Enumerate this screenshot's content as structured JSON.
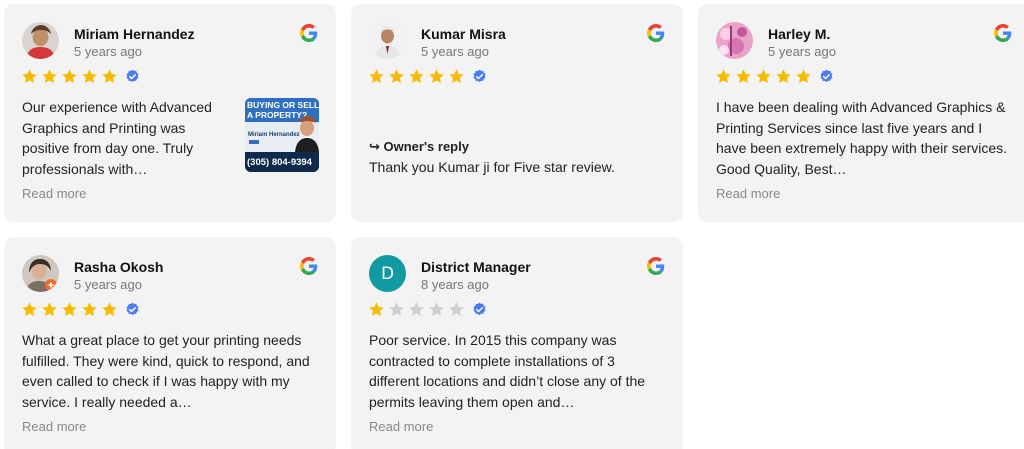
{
  "colors": {
    "card_bg": "#f3f3f3",
    "star_filled": "#f6bb06",
    "star_empty": "#cfcfcf",
    "verified_badge": "#4a7cf6",
    "district_avatar_bg": "#119aa2"
  },
  "reviews": [
    {
      "name": "Miriam Hernandez",
      "time_ago": "5 years ago",
      "rating": 5,
      "verified": true,
      "text": "Our experience with Advanced Graphics and Printing was positive from day one. Truly professionals with…",
      "read_more": "Read more",
      "attachment": {
        "headline_1": "BUYING OR SELLIN",
        "headline_2": "A PROPERTY?",
        "agent_name": "Miriam Hernandez",
        "phone": "(305) 804-9394"
      },
      "icon": "google-icon"
    },
    {
      "name": "Kumar Misra",
      "time_ago": "5 years ago",
      "rating": 5,
      "verified": true,
      "owner_reply_label": "↪ Owner's reply",
      "owner_reply_text": "Thank you Kumar ji for Five star review.",
      "icon": "google-icon"
    },
    {
      "name": "Harley M.",
      "time_ago": "5 years ago",
      "rating": 5,
      "verified": true,
      "text": "I have been dealing with Advanced Graphics & Printing Services since last five years and I have been extremely happy with their services. Good Quality, Best…",
      "read_more": "Read more",
      "icon": "google-icon"
    },
    {
      "name": "Rasha Okosh",
      "time_ago": "5 years ago",
      "rating": 5,
      "verified": true,
      "text": "What a great place to get your printing needs fulfilled. They were kind, quick to respond, and even called to check if I was happy with my service. I really needed a…",
      "read_more": "Read more",
      "icon": "google-icon"
    },
    {
      "name": "District Manager",
      "avatar_letter": "D",
      "time_ago": "8 years ago",
      "rating": 1,
      "verified": true,
      "text": "Poor service. In 2015 this company was contracted to complete installations of 3 different locations and didn’t close any of the permits leaving them open and…",
      "read_more": "Read more",
      "icon": "google-icon"
    }
  ]
}
